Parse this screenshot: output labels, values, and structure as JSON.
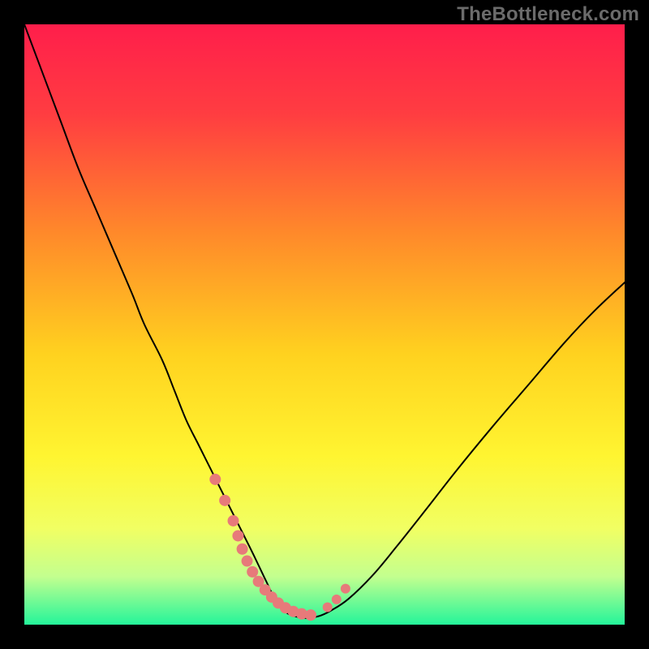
{
  "watermark": "TheBottleneck.com",
  "chart_data": {
    "type": "line",
    "title": "",
    "xlabel": "",
    "ylabel": "",
    "xlim": [
      0,
      100
    ],
    "ylim": [
      0,
      100
    ],
    "background_gradient": {
      "stops": [
        {
          "offset": 0,
          "color": "#ff1e4b"
        },
        {
          "offset": 15,
          "color": "#ff3d41"
        },
        {
          "offset": 35,
          "color": "#ff8a2a"
        },
        {
          "offset": 55,
          "color": "#ffd21f"
        },
        {
          "offset": 72,
          "color": "#fff531"
        },
        {
          "offset": 84,
          "color": "#f1ff63"
        },
        {
          "offset": 92,
          "color": "#c3ff8f"
        },
        {
          "offset": 100,
          "color": "#24f59a"
        }
      ]
    },
    "series": [
      {
        "name": "bottleneck-curve",
        "stroke": "#000000",
        "x": [
          0,
          3,
          6,
          9,
          12,
          15,
          18,
          20,
          23,
          25,
          27,
          29,
          31,
          33,
          35,
          36.5,
          38,
          39.2,
          40.3,
          41.2,
          42,
          43,
          44,
          45.5,
          47,
          49,
          51,
          54,
          58,
          62,
          67,
          72,
          78,
          84,
          90,
          95,
          100
        ],
        "y": [
          100,
          92,
          84,
          76,
          69,
          62,
          55,
          50,
          44,
          39,
          34,
          30,
          26,
          22,
          18,
          15,
          12,
          9.5,
          7.2,
          5.3,
          3.8,
          2.6,
          1.8,
          1.3,
          1.1,
          1.4,
          2.3,
          4.3,
          8.2,
          13,
          19.3,
          25.7,
          33,
          40,
          47,
          52.3,
          57
        ]
      }
    ],
    "markers": [
      {
        "name": "marker-group-left",
        "color": "#e77a7a",
        "x": [
          31.8,
          33.4,
          34.8,
          35.6,
          36.3
        ],
        "y": [
          24.2,
          20.7,
          17.3,
          14.8,
          12.6
        ],
        "r": 7
      },
      {
        "name": "marker-group-valley",
        "color": "#e77a7a",
        "x": [
          37.1,
          38,
          39,
          40.1,
          41.2,
          42.3,
          43.5,
          44.8,
          46.2,
          47.7
        ],
        "y": [
          10.6,
          8.8,
          7.2,
          5.8,
          4.6,
          3.6,
          2.8,
          2.2,
          1.8,
          1.6
        ],
        "r": 7
      },
      {
        "name": "marker-group-right",
        "color": "#e77a7a",
        "x": [
          50.5,
          52,
          53.5
        ],
        "y": [
          2.9,
          4.2,
          6.0
        ],
        "r": 6
      }
    ]
  }
}
